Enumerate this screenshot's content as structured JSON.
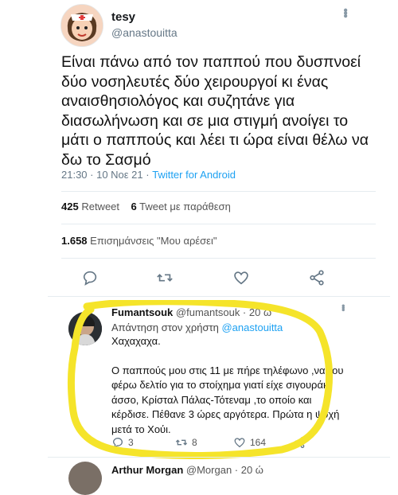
{
  "tweet": {
    "display_name": "tesy",
    "handle": "@anastouitta",
    "text": "Είναι πάνω από τον παππού που δυσπνοεί δύο νοσηλευτές δύο χειρουργοί κι ένας αναισθησιολόγος και συζητάνε για διασωλήνωση και σε μια στιγμή ανοίγει το μάτι ο παππούς και λέει τι ώρα είναι θέλω να δω το Σασμό",
    "time": "21:30 · 10 Νοε 21 · ",
    "source": "Twitter for Android",
    "retweet_count": "425",
    "retweet_label": "Retweet",
    "quote_count": "6",
    "quote_label": "Tweet με παράθεση",
    "like_count": "1.658",
    "like_label": "Επισημάνσεις \"Μου αρέσει\""
  },
  "reply": {
    "display_name": "Fumantsouk",
    "handle_time": "@fumantsouk · 20 ώ",
    "reply_to_prefix": "Απάντηση στον χρήστη ",
    "reply_to_handle": "@anastouitta",
    "line1": "Χαχαχαχα.",
    "text": "Ο παππούς μου στις 11 με πήρε τηλέφωνο ,να του φέρω δελτίο για το στοίχημα γιατί είχε σιγουράκι άσσο, Κρίσταλ Πάλας-Τότεναμ ,το οποίο και κέρδισε. Πέθανε 3 ώρες αργότερα. Πρώτα η ψυχή μετά το Χούι.",
    "reply_count": "3",
    "retweet_count": "8",
    "like_count": "164"
  },
  "next_reply": {
    "display_name": "Arthur Morgan",
    "handle_time": "@Morgan · 20 ώ"
  },
  "colors": {
    "accent": "#1da1f2",
    "highlight": "#f5e42a",
    "secondary_text": "#657786"
  }
}
